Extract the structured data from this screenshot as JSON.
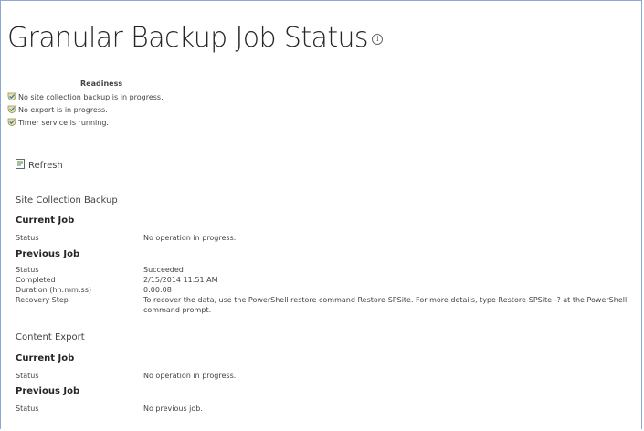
{
  "page": {
    "title": "Granular Backup Job Status",
    "info_glyph": "i"
  },
  "readiness": {
    "heading": "Readiness",
    "items": [
      "No site collection backup is in progress.",
      "No export is in progress.",
      "Timer service is running."
    ]
  },
  "toolbar": {
    "refresh_label": "Refresh"
  },
  "site_collection_backup": {
    "heading": "Site Collection Backup",
    "current_job": {
      "heading": "Current Job",
      "status_label": "Status",
      "status_value": "No operation in progress."
    },
    "previous_job": {
      "heading": "Previous Job",
      "status_label": "Status",
      "status_value": "Succeeded",
      "completed_label": "Completed",
      "completed_value": "2/15/2014 11:51 AM",
      "duration_label": "Duration (hh:mm:ss)",
      "duration_value": "0:00:08",
      "recovery_label": "Recovery Step",
      "recovery_value": "To recover the data, use the PowerShell restore command Restore-SPSite.  For more details, type Restore-SPSite -? at the PowerShell command prompt."
    }
  },
  "content_export": {
    "heading": "Content Export",
    "current_job": {
      "heading": "Current Job",
      "status_label": "Status",
      "status_value": "No operation in progress."
    },
    "previous_job": {
      "heading": "Previous Job",
      "status_label": "Status",
      "status_value": "No previous job."
    }
  },
  "icons": {
    "info": "info-icon",
    "check": "checkmark-shield-icon",
    "refresh": "refresh-document-icon"
  },
  "colors": {
    "frame_border": "#8aa9d6",
    "text": "#444444",
    "title": "#262626"
  }
}
